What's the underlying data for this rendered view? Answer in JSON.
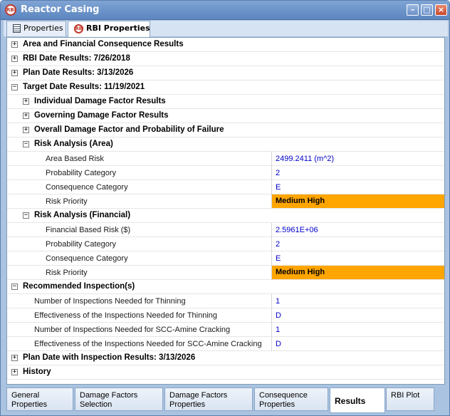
{
  "window": {
    "title": "Reactor Casing",
    "icon": "rbi-logo-icon",
    "controls": [
      "minimize",
      "maximize",
      "close"
    ]
  },
  "top_tabs": [
    {
      "label": "Properties",
      "icon": "properties-list-icon"
    },
    {
      "label": "RBI Properties",
      "icon": "rbi-logo-icon"
    }
  ],
  "rows": [
    {
      "type": "cat",
      "label": "Area and Financial Consequence Results",
      "expander": "+"
    },
    {
      "type": "cat",
      "label": "RBI Date Results: 7/26/2018",
      "expander": "+"
    },
    {
      "type": "cat",
      "label": "Plan Date Results: 3/13/2026",
      "expander": "+"
    },
    {
      "type": "cat",
      "label": "Target Date Results: 11/19/2021",
      "expander": "−"
    },
    {
      "type": "cat",
      "label": "Individual Damage Factor Results",
      "expander": "+"
    },
    {
      "type": "cat",
      "label": "Governing Damage Factor Results",
      "expander": "+"
    },
    {
      "type": "cat",
      "label": "Overall Damage Factor and Probability of Failure",
      "expander": "+"
    },
    {
      "type": "cat",
      "label": "Risk Analysis (Area)",
      "expander": "−"
    },
    {
      "type": "prop",
      "label": "Area Based Risk",
      "value": "2499.2411 (m^2)"
    },
    {
      "type": "prop",
      "label": "Probability Category",
      "value": "2"
    },
    {
      "type": "prop",
      "label": "Consequence Category",
      "value": "E"
    },
    {
      "type": "prop",
      "label": "Risk Priority",
      "value": "Medium High",
      "highlight": "#ffa500"
    },
    {
      "type": "cat",
      "label": "Risk Analysis (Financial)",
      "expander": "−"
    },
    {
      "type": "prop",
      "label": "Financial Based Risk ($)",
      "value": "2.5961E+06"
    },
    {
      "type": "prop",
      "label": "Probability Category",
      "value": "2"
    },
    {
      "type": "prop",
      "label": "Consequence Category",
      "value": "E"
    },
    {
      "type": "prop",
      "label": "Risk Priority",
      "value": "Medium High",
      "highlight": "#ffa500"
    },
    {
      "type": "cat",
      "label": "Recommended Inspection(s)",
      "expander": "−"
    },
    {
      "type": "prop",
      "label": "Number of Inspections Needed for Thinning",
      "value": "1"
    },
    {
      "type": "prop",
      "label": "Effectiveness of the Inspections Needed for Thinning",
      "value": "D"
    },
    {
      "type": "prop",
      "label": "Number of Inspections Needed for SCC-Amine Cracking",
      "value": "1"
    },
    {
      "type": "prop",
      "label": "Effectiveness of the Inspections Needed for SCC-Amine Cracking",
      "value": "D"
    },
    {
      "type": "cat",
      "label": "Plan Date with Inspection Results: 3/13/2026",
      "expander": "+"
    },
    {
      "type": "cat",
      "label": "History",
      "expander": "+"
    }
  ],
  "bottom_tabs": [
    {
      "label": "General\nProperties"
    },
    {
      "label": "Damage Factors\nSelection"
    },
    {
      "label": "Damage Factors\nProperties"
    },
    {
      "label": "Consequence\nProperties"
    },
    {
      "label": "Results"
    },
    {
      "label": "RBI Plot"
    }
  ],
  "colors": {
    "value_text": "#0000c8",
    "risk_priority_bg": "#ffa500",
    "title_bar": "#6b90c7"
  }
}
